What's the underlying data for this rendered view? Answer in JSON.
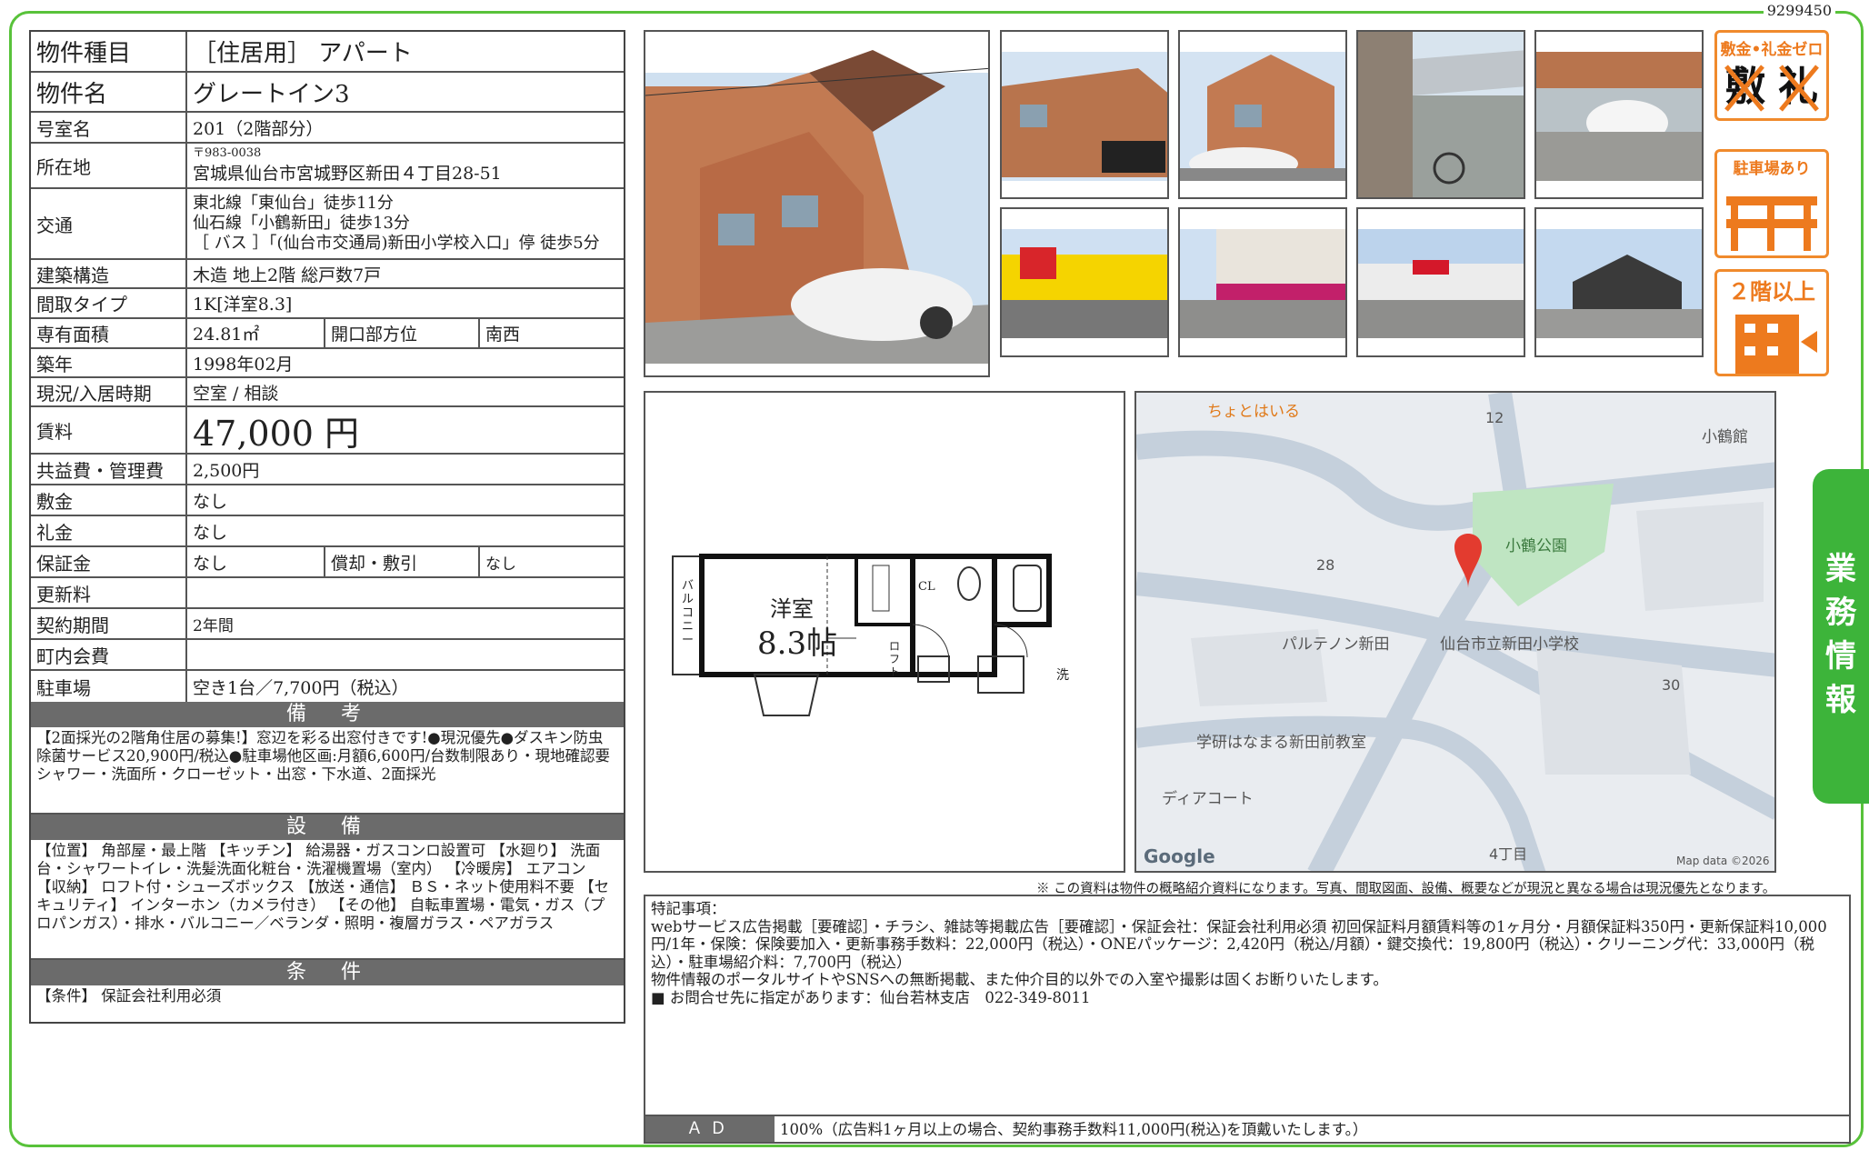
{
  "doc_id": "9299450",
  "property": {
    "type_label": "物件種目",
    "type_value": "［住居用］ アパート",
    "name_label": "物件名",
    "name_value": "グレートイン3",
    "room_label": "号室名",
    "room_value": "201（2階部分）",
    "addr_label": "所在地",
    "zip": "〒983-0038",
    "addr_value": "宮城県仙台市宮城野区新田４丁目28-51",
    "access_label": "交通",
    "access": [
      "東北線「東仙台」徒歩11分",
      "仙石線「小鶴新田」徒歩13分",
      "［ バス ］「(仙台市交通局)新田小学校入口」停 徒歩5分"
    ],
    "structure_label": "建築構造",
    "structure_value": "木造 地上2階 総戸数7戸",
    "layout_label": "間取タイプ",
    "layout_value": "1K[洋室8.3]",
    "area_label": "専有面積",
    "area_value": "24.81㎡",
    "facing_label": "開口部方位",
    "facing_value": "南西",
    "built_label": "築年",
    "built_value": "1998年02月",
    "status_label": "現況/入居時期",
    "status_value": "空室 / 相談",
    "rent_label": "賃料",
    "rent_value": "47,000 円",
    "fee_label": "共益費・管理費",
    "fee_value": "2,500円",
    "deposit_label": "敷金",
    "deposit_value": "なし",
    "key_label": "礼金",
    "key_value": "なし",
    "guarantee_label": "保証金",
    "guarantee_value": "なし",
    "amort_label": "償却・敷引",
    "amort_value": "なし",
    "renew_label": "更新料",
    "renew_value": "",
    "contract_label": "契約期間",
    "contract_value": "2年間",
    "town_label": "町内会費",
    "town_value": "",
    "parking_label": "駐車場",
    "parking_value": "空き1台／7,700円（税込）"
  },
  "remarks": {
    "title": "備　考",
    "text": "【2面採光の2階角住居の募集!】窓辺を彩る出窓付きです!●現況優先●ダスキン防虫除菌サービス20,900円/税込●駐車場他区画:月額6,600円/台数制限あり・現地確認要 シャワー・洗面所・クローゼット・出窓・下水道、2面採光"
  },
  "facilities": {
    "title": "設　備",
    "text": "【位置】 角部屋・最上階 【キッチン】 給湯器・ガスコンロ設置可 【水廻り】 洗面台・シャワートイレ・洗髪洗面化粧台・洗濯機置場（室内） 【冷暖房】 エアコン 【収納】 ロフト付・シューズボックス 【放送・通信】 ＢＳ・ネット使用料不要 【セキュリティ】 インターホン（カメラ付き） 【その他】 自転車置場・電気・ガス（プロパンガス）・排水・バルコニー／ベランダ・照明・複層ガラス・ペアガラス"
  },
  "conditions": {
    "title": "条　件",
    "text": "【条件】 保証会社利用必須"
  },
  "badges": {
    "zero": "敷金•礼金ゼロ",
    "zero_mark1": "敷",
    "zero_mark2": "礼",
    "parking": "駐車場あり",
    "floor": "２階以上"
  },
  "floorplan": {
    "room": "洋室",
    "size": "8.3帖",
    "balcony": "バルコニー",
    "cl": "CL",
    "loft": "ロフト",
    "wash": "洗"
  },
  "map": {
    "labels": [
      "ちょとはいる",
      "12",
      "小鶴館",
      "小鶴公園",
      "28",
      "パルテノン新田",
      "仙台市立新田小学校",
      "30",
      "学研はなまる新田前教室",
      "ディアコート",
      "4丁目"
    ],
    "google": "Google",
    "credit": "Map data ©2026"
  },
  "disclaimer": "※ この資料は物件の概略紹介資料になります。写真、間取図面、設備、概要などが現況と異なる場合は現況優先となります。",
  "special": {
    "title": "特記事項：",
    "lines": [
      "webサービス広告掲載［要確認］・チラシ、雑誌等掲載広告［要確認］・保証会社：保証会社利用必須 初回保証料月額賃料等の1ヶ月分・月額保証料350円・更新保証料10,000円/1年・保険：保険要加入・更新事務手数料：22,000円（税込）・ONEパッケージ：2,420円（税込/月額）・鍵交換代：19,800円（税込）・クリーニング代：33,000円（税込）・駐車場紹介料：7,700円（税込）",
      "物件情報のポータルサイトやSNSへの無断掲載、また仲介目的以外での入室や撮影は固くお断りいたします。",
      "■ お問合せ先に指定があります：仙台若林支店　022-349-8011"
    ]
  },
  "ad": {
    "label": "ＡＤ",
    "value": "100%（広告料1ヶ月以上の場合、契約事務手数料11,000円(税込)を頂戴いたします。）"
  },
  "side_tab": "業務情報"
}
